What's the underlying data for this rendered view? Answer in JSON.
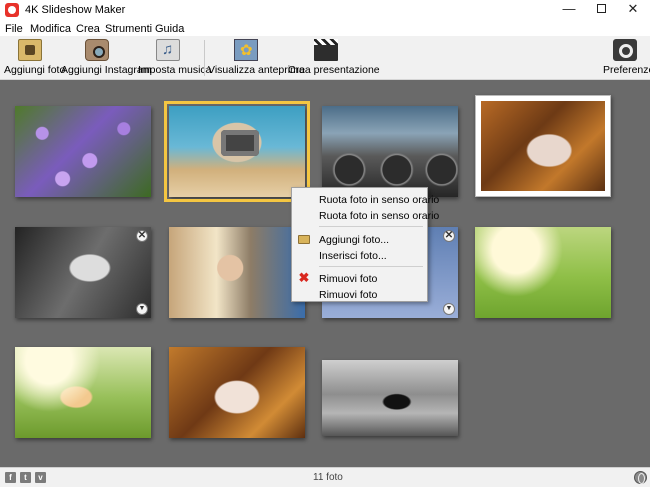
{
  "window": {
    "title": "4K Slideshow Maker",
    "controls": {
      "minimize": "—",
      "close": "✕"
    }
  },
  "menu": [
    "File",
    "Modifica",
    "Crea",
    "Strumenti",
    "Guida"
  ],
  "toolbar": {
    "add_photo": "Aggiungi foto",
    "add_instagram": "Aggiungi Instagram",
    "set_music": "Imposta musica",
    "preview": "Visualizza anteprima",
    "create": "Crea presentazione",
    "preferences": "Preferenze"
  },
  "photos": [
    {
      "name": "photo-purple-flowers"
    },
    {
      "name": "photo-camera-girl",
      "selected": true
    },
    {
      "name": "photo-industrial-machine"
    },
    {
      "name": "photo-stamp-framed"
    },
    {
      "name": "photo-woman-leaves-bw"
    },
    {
      "name": "photo-lollipop-girl"
    },
    {
      "name": "photo-partial-hidden"
    },
    {
      "name": "photo-field-sunlight"
    },
    {
      "name": "photo-hat-girl-field"
    },
    {
      "name": "photo-autumn-leaves-woman"
    },
    {
      "name": "photo-bw-street-man"
    }
  ],
  "tile_controls": {
    "remove": "✕",
    "menu": "▼"
  },
  "context_menu": {
    "rotate_cw": "Ruota foto in senso orario",
    "rotate_ccw": "Ruota foto in senso orario",
    "add_photo": "Aggiungi foto...",
    "insert_photo": "Inserisci foto...",
    "remove_photo": "Rimuovi foto",
    "remove_photos": "Rimuovi foto",
    "remove_icon": "✖"
  },
  "statusbar": {
    "count": "11 foto",
    "social": [
      "f",
      "t",
      "v"
    ]
  },
  "colors": {
    "stage_bg": "#6a6a6a",
    "selection": "#f4c642",
    "toolbar_bg": "#f1f1f1",
    "remove_red": "#d9271e"
  }
}
